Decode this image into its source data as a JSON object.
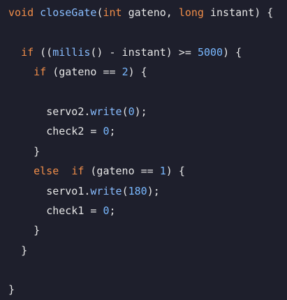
{
  "colors": {
    "background": "#1e1f2c",
    "keyword": "#f08d49",
    "function": "#89bdff",
    "number": "#79b8ff",
    "plain": "#e6e6e6"
  },
  "code": {
    "language": "C++ (Arduino)",
    "lines": [
      {
        "indent": "",
        "tokens": [
          {
            "t": "void",
            "k": "keyword"
          },
          {
            "t": " ",
            "k": "plain"
          },
          {
            "t": "closeGate",
            "k": "function"
          },
          {
            "t": "(",
            "k": "plain"
          },
          {
            "t": "int",
            "k": "keyword"
          },
          {
            "t": " gateno, ",
            "k": "plain"
          },
          {
            "t": "long",
            "k": "keyword"
          },
          {
            "t": " instant) {",
            "k": "plain"
          }
        ]
      },
      {
        "indent": "",
        "tokens": []
      },
      {
        "indent": "  ",
        "tokens": [
          {
            "t": "if",
            "k": "keyword"
          },
          {
            "t": " ((",
            "k": "plain"
          },
          {
            "t": "millis",
            "k": "function"
          },
          {
            "t": "() - instant) >= ",
            "k": "plain"
          },
          {
            "t": "5000",
            "k": "number"
          },
          {
            "t": ") {",
            "k": "plain"
          }
        ]
      },
      {
        "indent": "    ",
        "tokens": [
          {
            "t": "if",
            "k": "keyword"
          },
          {
            "t": " (gateno == ",
            "k": "plain"
          },
          {
            "t": "2",
            "k": "number"
          },
          {
            "t": ") {",
            "k": "plain"
          }
        ]
      },
      {
        "indent": "",
        "tokens": []
      },
      {
        "indent": "      ",
        "tokens": [
          {
            "t": "servo2.",
            "k": "plain"
          },
          {
            "t": "write",
            "k": "function"
          },
          {
            "t": "(",
            "k": "plain"
          },
          {
            "t": "0",
            "k": "number"
          },
          {
            "t": ");",
            "k": "plain"
          }
        ]
      },
      {
        "indent": "      ",
        "tokens": [
          {
            "t": "check2 = ",
            "k": "plain"
          },
          {
            "t": "0",
            "k": "number"
          },
          {
            "t": ";",
            "k": "plain"
          }
        ]
      },
      {
        "indent": "    ",
        "tokens": [
          {
            "t": "}",
            "k": "plain"
          }
        ]
      },
      {
        "indent": "    ",
        "tokens": [
          {
            "t": "else",
            "k": "keyword"
          },
          {
            "t": "  ",
            "k": "plain"
          },
          {
            "t": "if",
            "k": "keyword"
          },
          {
            "t": " (gateno == ",
            "k": "plain"
          },
          {
            "t": "1",
            "k": "number"
          },
          {
            "t": ") {",
            "k": "plain"
          }
        ]
      },
      {
        "indent": "      ",
        "tokens": [
          {
            "t": "servo1.",
            "k": "plain"
          },
          {
            "t": "write",
            "k": "function"
          },
          {
            "t": "(",
            "k": "plain"
          },
          {
            "t": "180",
            "k": "number"
          },
          {
            "t": ");",
            "k": "plain"
          }
        ]
      },
      {
        "indent": "      ",
        "tokens": [
          {
            "t": "check1 = ",
            "k": "plain"
          },
          {
            "t": "0",
            "k": "number"
          },
          {
            "t": ";",
            "k": "plain"
          }
        ]
      },
      {
        "indent": "    ",
        "tokens": [
          {
            "t": "}",
            "k": "plain"
          }
        ]
      },
      {
        "indent": "  ",
        "tokens": [
          {
            "t": "}",
            "k": "plain"
          }
        ]
      },
      {
        "indent": "",
        "tokens": []
      },
      {
        "indent": "",
        "tokens": [
          {
            "t": "}",
            "k": "plain"
          }
        ]
      }
    ]
  }
}
